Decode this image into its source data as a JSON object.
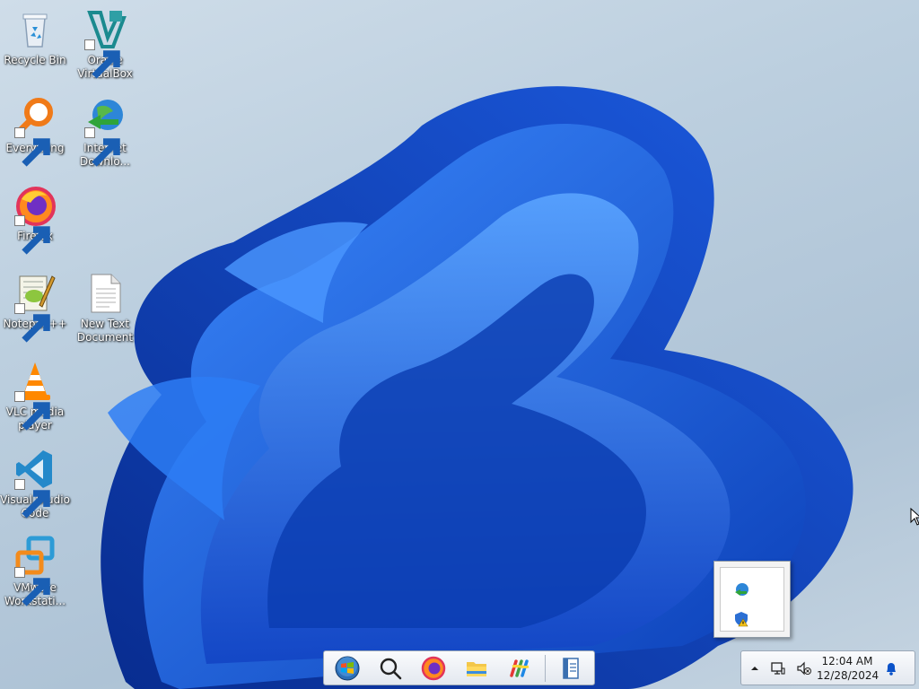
{
  "desktop": {
    "icons": [
      {
        "label": "Recycle Bin",
        "icon": "recycle-bin-icon"
      },
      {
        "label": "Oracle VirtualBox",
        "icon": "virtualbox-icon"
      },
      {
        "label": "Everything",
        "icon": "everything-search-icon"
      },
      {
        "label": "Internet Downlo...",
        "icon": "internet-download-manager-icon"
      },
      {
        "label": "Firefox",
        "icon": "firefox-icon"
      },
      {
        "label": "Notepad++",
        "icon": "notepad-plus-plus-icon"
      },
      {
        "label": "New Text Document",
        "icon": "text-document-icon"
      },
      {
        "label": "VLC media player",
        "icon": "vlc-icon"
      },
      {
        "label": "Visual Studio Code",
        "icon": "vscode-icon"
      },
      {
        "label": "VMware Workstati...",
        "icon": "vmware-icon"
      }
    ]
  },
  "taskbar": {
    "buttons": [
      {
        "icon": "start-orb-icon"
      },
      {
        "icon": "search-icon"
      },
      {
        "icon": "firefox-icon"
      },
      {
        "icon": "file-explorer-icon"
      },
      {
        "icon": "colorful-app-icon"
      },
      {
        "icon": "document-app-icon"
      }
    ]
  },
  "tray_popup": {
    "icons": [
      "internet-download-manager-icon",
      "windows-security-warning-icon"
    ]
  },
  "notification_area": {
    "icons": [
      "show-hidden-icons-arrow",
      "network-monitor-icon",
      "speaker-muted-icon",
      "notification-bell-icon"
    ],
    "clock_time": "12:04 AM",
    "clock_date": "12/28/2024"
  },
  "colors": {
    "wallpaper_blue": "#1f63e0",
    "taskbar": "#eef1f5",
    "accent": "#0a52c9"
  }
}
